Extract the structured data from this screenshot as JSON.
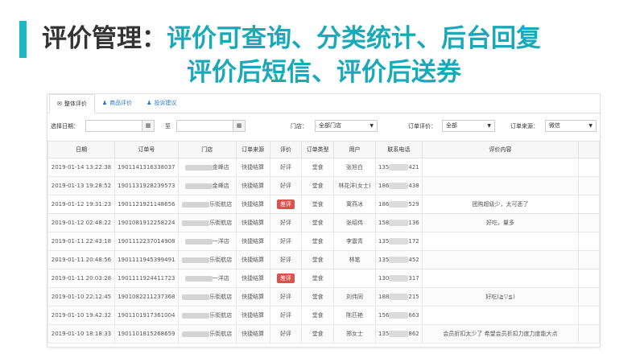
{
  "slide": {
    "title_prefix": "评价管理：",
    "title_features_line1": "评价可查询、分类统计、后台回复",
    "title_features_line2": "评价后短信、评价后送券",
    "accent_color": "#1bb7c6"
  },
  "tabs": [
    {
      "label": "整体评价",
      "icon": "comments-icon",
      "glyph": "✉",
      "active": true
    },
    {
      "label": "商品评价",
      "icon": "user-icon",
      "glyph": "♟",
      "active": false
    },
    {
      "label": "投诉建议",
      "icon": "user-icon",
      "glyph": "♟",
      "active": false
    }
  ],
  "filters": {
    "date_label": "选择日期：",
    "date_separator": "至",
    "date_start_value": "",
    "date_end_value": "",
    "calendar_icon": "calendar-icon",
    "store_label": "门店：",
    "store_value": "全部门店",
    "rating_label": "订单评价：",
    "rating_value": "全部",
    "source_label": "订单来源：",
    "source_value": "微信"
  },
  "table": {
    "columns": [
      "日期",
      "订单号",
      "门店",
      "订单来源",
      "评价",
      "订单类型",
      "用户",
      "联系电话",
      "评价内容",
      ""
    ],
    "rows": [
      {
        "date": "2019-01-14 13:22:38",
        "order_no": "1901141316338037",
        "store_suffix": "金峰店",
        "source": "快捷结算",
        "rating": "好评",
        "bad": false,
        "type": "堂食",
        "user": "张旭白",
        "phone_prefix": "135",
        "phone_suffix": "421",
        "content": ""
      },
      {
        "date": "2019-01-13 19:28:52",
        "order_no": "1901131928239573",
        "store_suffix": "金峰店",
        "source": "快捷结算",
        "rating": "好评",
        "bad": false,
        "type": "堂食",
        "user": "林花洋(女士)",
        "phone_prefix": "186",
        "phone_suffix": "438",
        "content": ""
      },
      {
        "date": "2019-01-12 19:31:23",
        "order_no": "1901121921148656",
        "store_suffix": "乐街航店",
        "source": "快捷结算",
        "rating": "差评",
        "bad": true,
        "type": "堂食",
        "user": "寓燕冰",
        "phone_prefix": "186",
        "phone_suffix": "529",
        "content": "团购超级少，太可恶了"
      },
      {
        "date": "2019-01-12 02:48:22",
        "order_no": "1901081912258224",
        "store_suffix": "乐街航店",
        "source": "快捷结算",
        "rating": "好评",
        "bad": false,
        "type": "堂食",
        "user": "张绍伟",
        "phone_prefix": "158",
        "phone_suffix": "136",
        "content": "好吃，量多"
      },
      {
        "date": "2019-01-11 22:43:18",
        "order_no": "1901112237014908",
        "store_suffix": "一洋店",
        "source": "快捷结算",
        "rating": "好评",
        "bad": false,
        "type": "堂食",
        "user": "李震青",
        "phone_prefix": "135",
        "phone_suffix": "172",
        "content": ""
      },
      {
        "date": "2019-01-11 20:48:56",
        "order_no": "1901111945399491",
        "store_suffix": "乐街航店",
        "source": "快捷结算",
        "rating": "好评",
        "bad": false,
        "type": "堂食",
        "user": "林笔",
        "phone_prefix": "135",
        "phone_suffix": "452",
        "content": ""
      },
      {
        "date": "2019-01-11 20:03:28",
        "order_no": "1901111924411723",
        "store_suffix": "一洋店",
        "source": "快捷结算",
        "rating": "差评",
        "bad": true,
        "type": "堂食",
        "user": "",
        "phone_prefix": "130",
        "phone_suffix": "317",
        "content": ""
      },
      {
        "date": "2019-01-10 22:12:45",
        "order_no": "1901082211237368",
        "store_suffix": "乐街航店",
        "source": "快捷结算",
        "rating": "好评",
        "bad": false,
        "type": "堂食",
        "user": "刘伟同",
        "phone_prefix": "188",
        "phone_suffix": "215",
        "content": "好吃(≧▽≦)"
      },
      {
        "date": "2019-01-10 19:42:32",
        "order_no": "1901101917361004",
        "store_suffix": "乐街航店",
        "source": "快捷结算",
        "rating": "好评",
        "bad": false,
        "type": "堂食",
        "user": "陈匹艳",
        "phone_prefix": "156",
        "phone_suffix": "663",
        "content": ""
      },
      {
        "date": "2019-01-10 18:18:33",
        "order_no": "1901101815268659",
        "store_suffix": "乐街航店",
        "source": "快捷结算",
        "rating": "好评",
        "bad": false,
        "type": "堂食",
        "user": "郑女士",
        "phone_prefix": "135",
        "phone_suffix": "862",
        "content": "会员折扣太少了 希望会员折扣力度力度能大点"
      }
    ]
  }
}
